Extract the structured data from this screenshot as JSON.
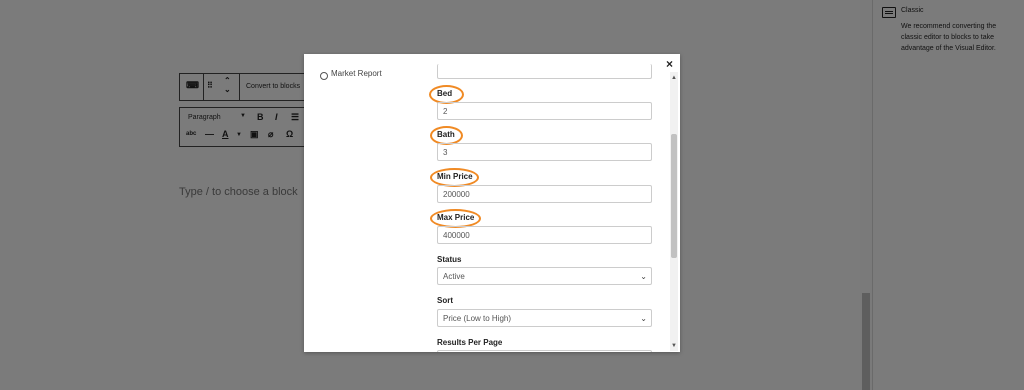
{
  "editor": {
    "convert_label": "Convert to blocks",
    "paragraph_label": "Paragraph",
    "placeholder": "Type / to choose a block"
  },
  "sidebar": {
    "block_title": "Classic",
    "block_desc": "We recommend converting the classic editor to blocks to take advantage of the Visual Editor."
  },
  "modal": {
    "close_icon": "×",
    "radio_label": "Market Report",
    "fields": {
      "bed_label": "Bed",
      "bed_value": "2",
      "bath_label": "Bath",
      "bath_value": "3",
      "min_price_label": "Min Price",
      "min_price_value": "200000",
      "max_price_label": "Max Price",
      "max_price_value": "400000",
      "status_label": "Status",
      "status_value": "Active",
      "sort_label": "Sort",
      "sort_value": "Price (Low to High)",
      "results_label": "Results Per Page"
    }
  },
  "colors": {
    "highlight": "#f08a24",
    "overlay": "#7b7b7b"
  }
}
